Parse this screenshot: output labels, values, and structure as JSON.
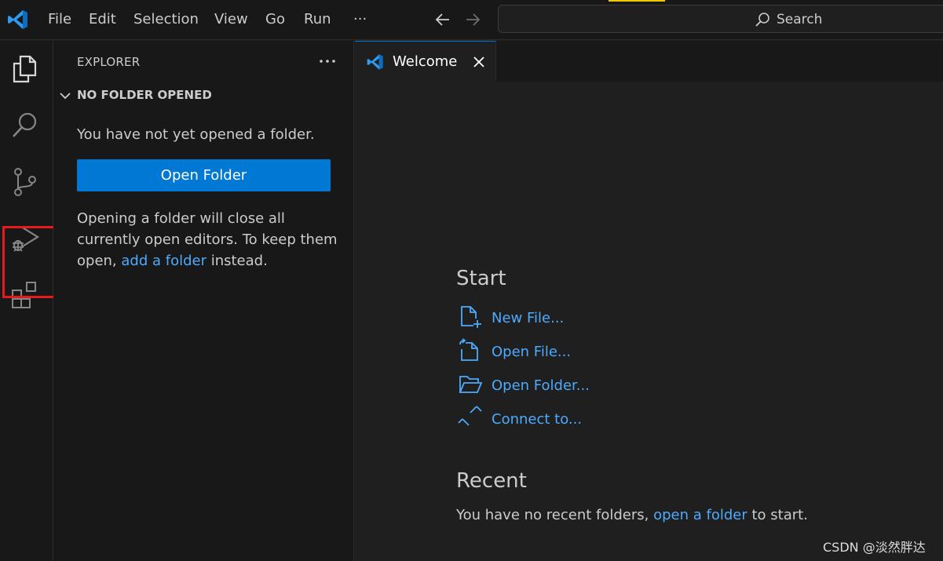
{
  "titlebar": {
    "menu": [
      "File",
      "Edit",
      "Selection",
      "View",
      "Go",
      "Run"
    ],
    "more": "···",
    "search_label": "Search"
  },
  "sidebar": {
    "title": "EXPLORER",
    "more": "···",
    "section_title": "NO FOLDER OPENED",
    "no_folder_text": "You have not yet opened a folder.",
    "open_folder_button": "Open Folder",
    "info_line1": "Opening a folder will close all",
    "info_line2": "currently open editors. To keep them",
    "info_line3_prefix": "open, ",
    "info_link": "add a folder",
    "info_line3_suffix": " instead."
  },
  "editor": {
    "tab_label": "Welcome",
    "start_heading": "Start",
    "start_items": [
      "New File...",
      "Open File...",
      "Open Folder...",
      "Connect to..."
    ],
    "recent_heading": "Recent",
    "recent_prefix": "You have no recent folders, ",
    "recent_link": "open a folder",
    "recent_suffix": " to start."
  },
  "watermark": "CSDN @淡然胖达",
  "colors": {
    "accent": "#0078d4",
    "link": "#4daafc",
    "highlight": "#e8191b"
  }
}
